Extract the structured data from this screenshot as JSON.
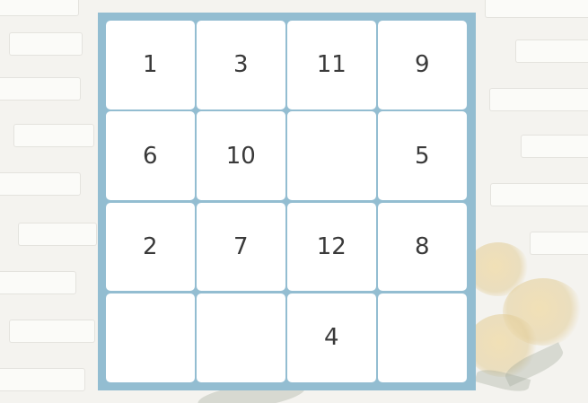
{
  "puzzle": {
    "tiles": [
      "1",
      "3",
      "11",
      "9",
      "6",
      "10",
      "",
      "5",
      "2",
      "7",
      "12",
      "8",
      "",
      "",
      "4",
      ""
    ]
  },
  "colors": {
    "board_frame": "#93bdd1",
    "tile_background": "#ffffff",
    "tile_text": "#3a3a3a"
  }
}
